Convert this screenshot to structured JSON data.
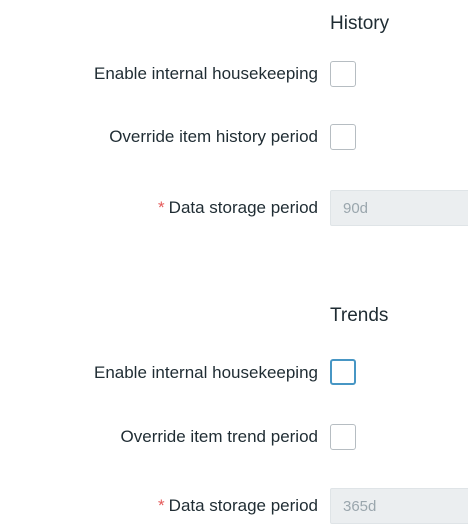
{
  "history": {
    "title": "History",
    "enable_housekeeping_label": "Enable internal housekeeping",
    "enable_housekeeping_checked": false,
    "override_label": "Override item history period",
    "override_checked": false,
    "storage_required_mark": "*",
    "storage_label": "Data storage period",
    "storage_value": "90d"
  },
  "trends": {
    "title": "Trends",
    "enable_housekeeping_label": "Enable internal housekeeping",
    "enable_housekeeping_checked": false,
    "override_label": "Override item trend period",
    "override_checked": false,
    "storage_required_mark": "*",
    "storage_label": "Data storage period",
    "storage_value": "365d"
  },
  "colors": {
    "required": "#e45959",
    "text": "#1f2c33",
    "checkbox_border": "#b6bdc2",
    "checkbox_focus_border": "#4796c4",
    "disabled_input_bg": "#ebeef0"
  }
}
